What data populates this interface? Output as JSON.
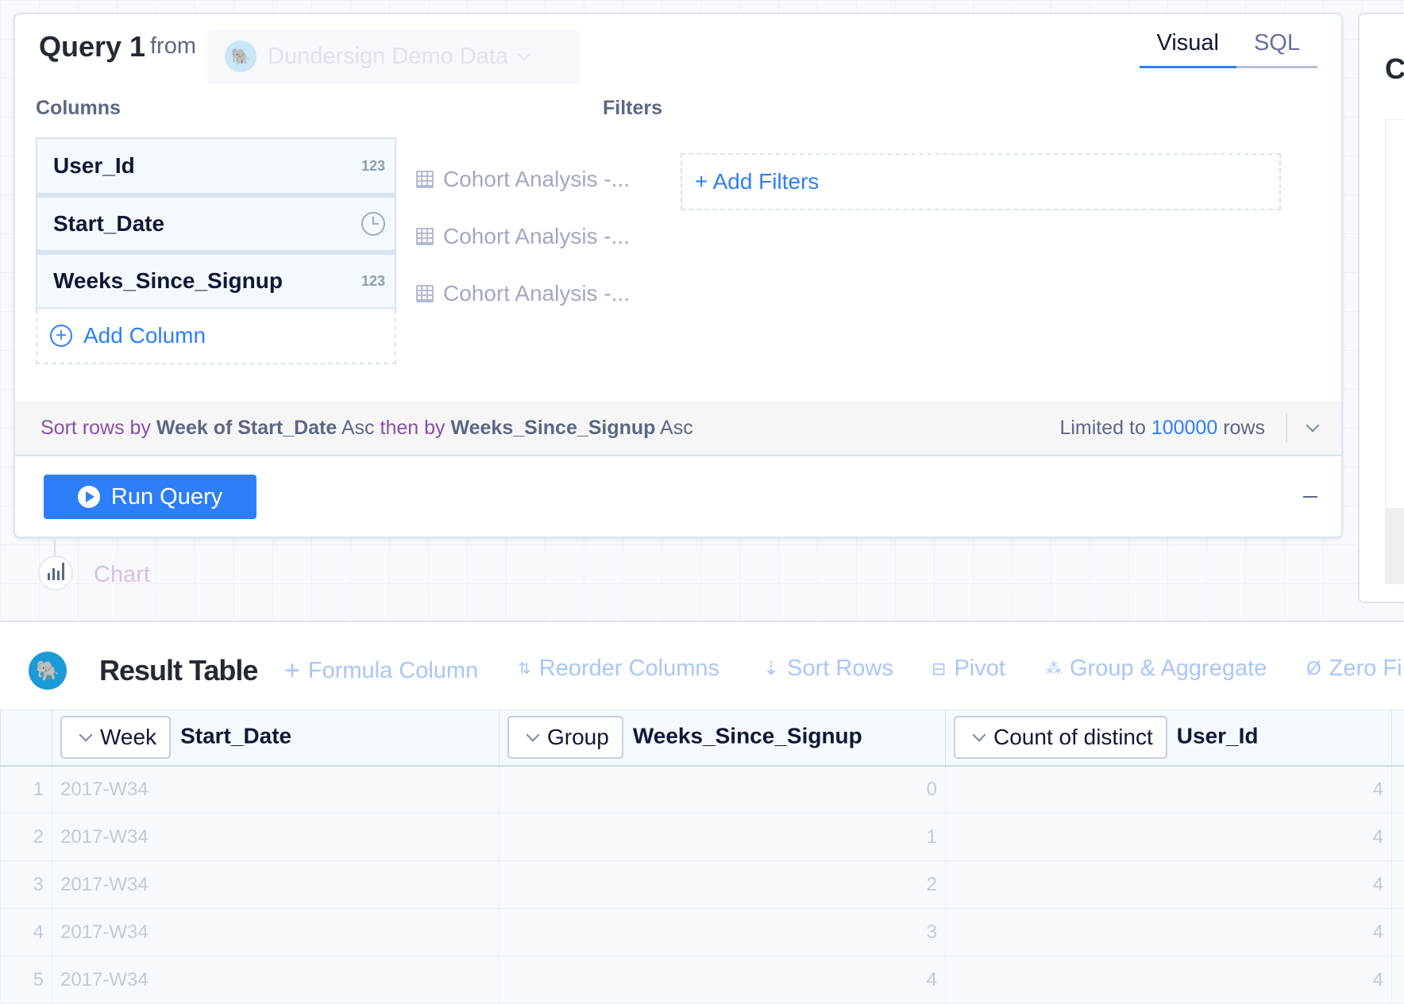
{
  "query": {
    "title": "Query 1",
    "from": "from",
    "datasource": "Dundersign Demo Data",
    "tabs": [
      {
        "label": "Visual",
        "active": true
      },
      {
        "label": "SQL",
        "active": false
      }
    ],
    "columns_label": "Columns",
    "filters_label": "Filters",
    "columns": [
      {
        "name": "User_Id",
        "type": "123",
        "type_icon": "number",
        "source": "Cohort Analysis -..."
      },
      {
        "name": "Start_Date",
        "type_icon": "clock-icon",
        "source": "Cohort Analysis -..."
      },
      {
        "name": "Weeks_Since_Signup",
        "type": "123",
        "type_icon": "number",
        "source": "Cohort Analysis -..."
      }
    ],
    "add_column": "Add Column",
    "add_filters": "+ Add Filters",
    "sort": {
      "p1": "Sort rows by",
      "f1": "Week of Start_Date",
      "d1": "Asc",
      "p2": "then by",
      "f2": "Weeks_Since_Signup",
      "d2": "Asc"
    },
    "limit": {
      "pre": "Limited to",
      "value": "100000",
      "post": "rows"
    },
    "run": "Run Query"
  },
  "chart_node": "Chart",
  "right_panel_title": "Cl",
  "result": {
    "title": "Result Table",
    "tools": [
      "Formula Column",
      "Reorder Columns",
      "Sort Rows",
      "Pivot",
      "Group & Aggregate",
      "Zero Fi"
    ],
    "headers": [
      {
        "agg": "Week",
        "name": "Start_Date"
      },
      {
        "agg": "Group",
        "name": "Weeks_Since_Signup"
      },
      {
        "agg": "Count of distinct",
        "name": "User_Id"
      }
    ],
    "rows": [
      [
        "1",
        "2017-W34",
        "0",
        "4"
      ],
      [
        "2",
        "2017-W34",
        "1",
        "4"
      ],
      [
        "3",
        "2017-W34",
        "2",
        "4"
      ],
      [
        "4",
        "2017-W34",
        "3",
        "4"
      ],
      [
        "5",
        "2017-W34",
        "4",
        "4"
      ]
    ]
  },
  "colors": {
    "accent": "#2d7ff9",
    "sort_purple": "#8a4fa6",
    "logo": "#1a9bd7"
  }
}
